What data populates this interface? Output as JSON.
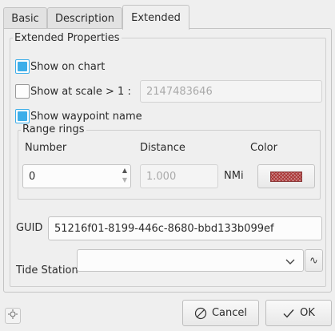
{
  "tabs": [
    {
      "label": "Basic"
    },
    {
      "label": "Description"
    },
    {
      "label": "Extended"
    }
  ],
  "extended": {
    "title": "Extended Properties",
    "show_on_chart": {
      "label": "Show on chart",
      "checked": true
    },
    "show_at_scale": {
      "label": "Show at scale > 1 :",
      "checked": false,
      "value": "2147483646"
    },
    "show_waypoint_name": {
      "label": "Show waypoint name",
      "checked": true
    },
    "range_rings": {
      "title": "Range rings",
      "number_label": "Number",
      "number_value": "0",
      "distance_label": "Distance",
      "distance_value": "1.000",
      "unit": "NMi",
      "color_label": "Color",
      "color_swatch": "#c98a8a"
    },
    "guid_label": "GUID",
    "guid_value": "51216f01-8199-446c-8680-bbd133b099ef",
    "tide_station_label": "Tide Station",
    "tide_station_value": "",
    "tide_button_label": "∿"
  },
  "buttons": {
    "cancel": "Cancel",
    "ok": "OK"
  },
  "icons": {
    "cancel": "cancel-icon",
    "ok": "checkmark-icon",
    "chevron": "chevron-down-icon",
    "corner": "location-icon"
  }
}
